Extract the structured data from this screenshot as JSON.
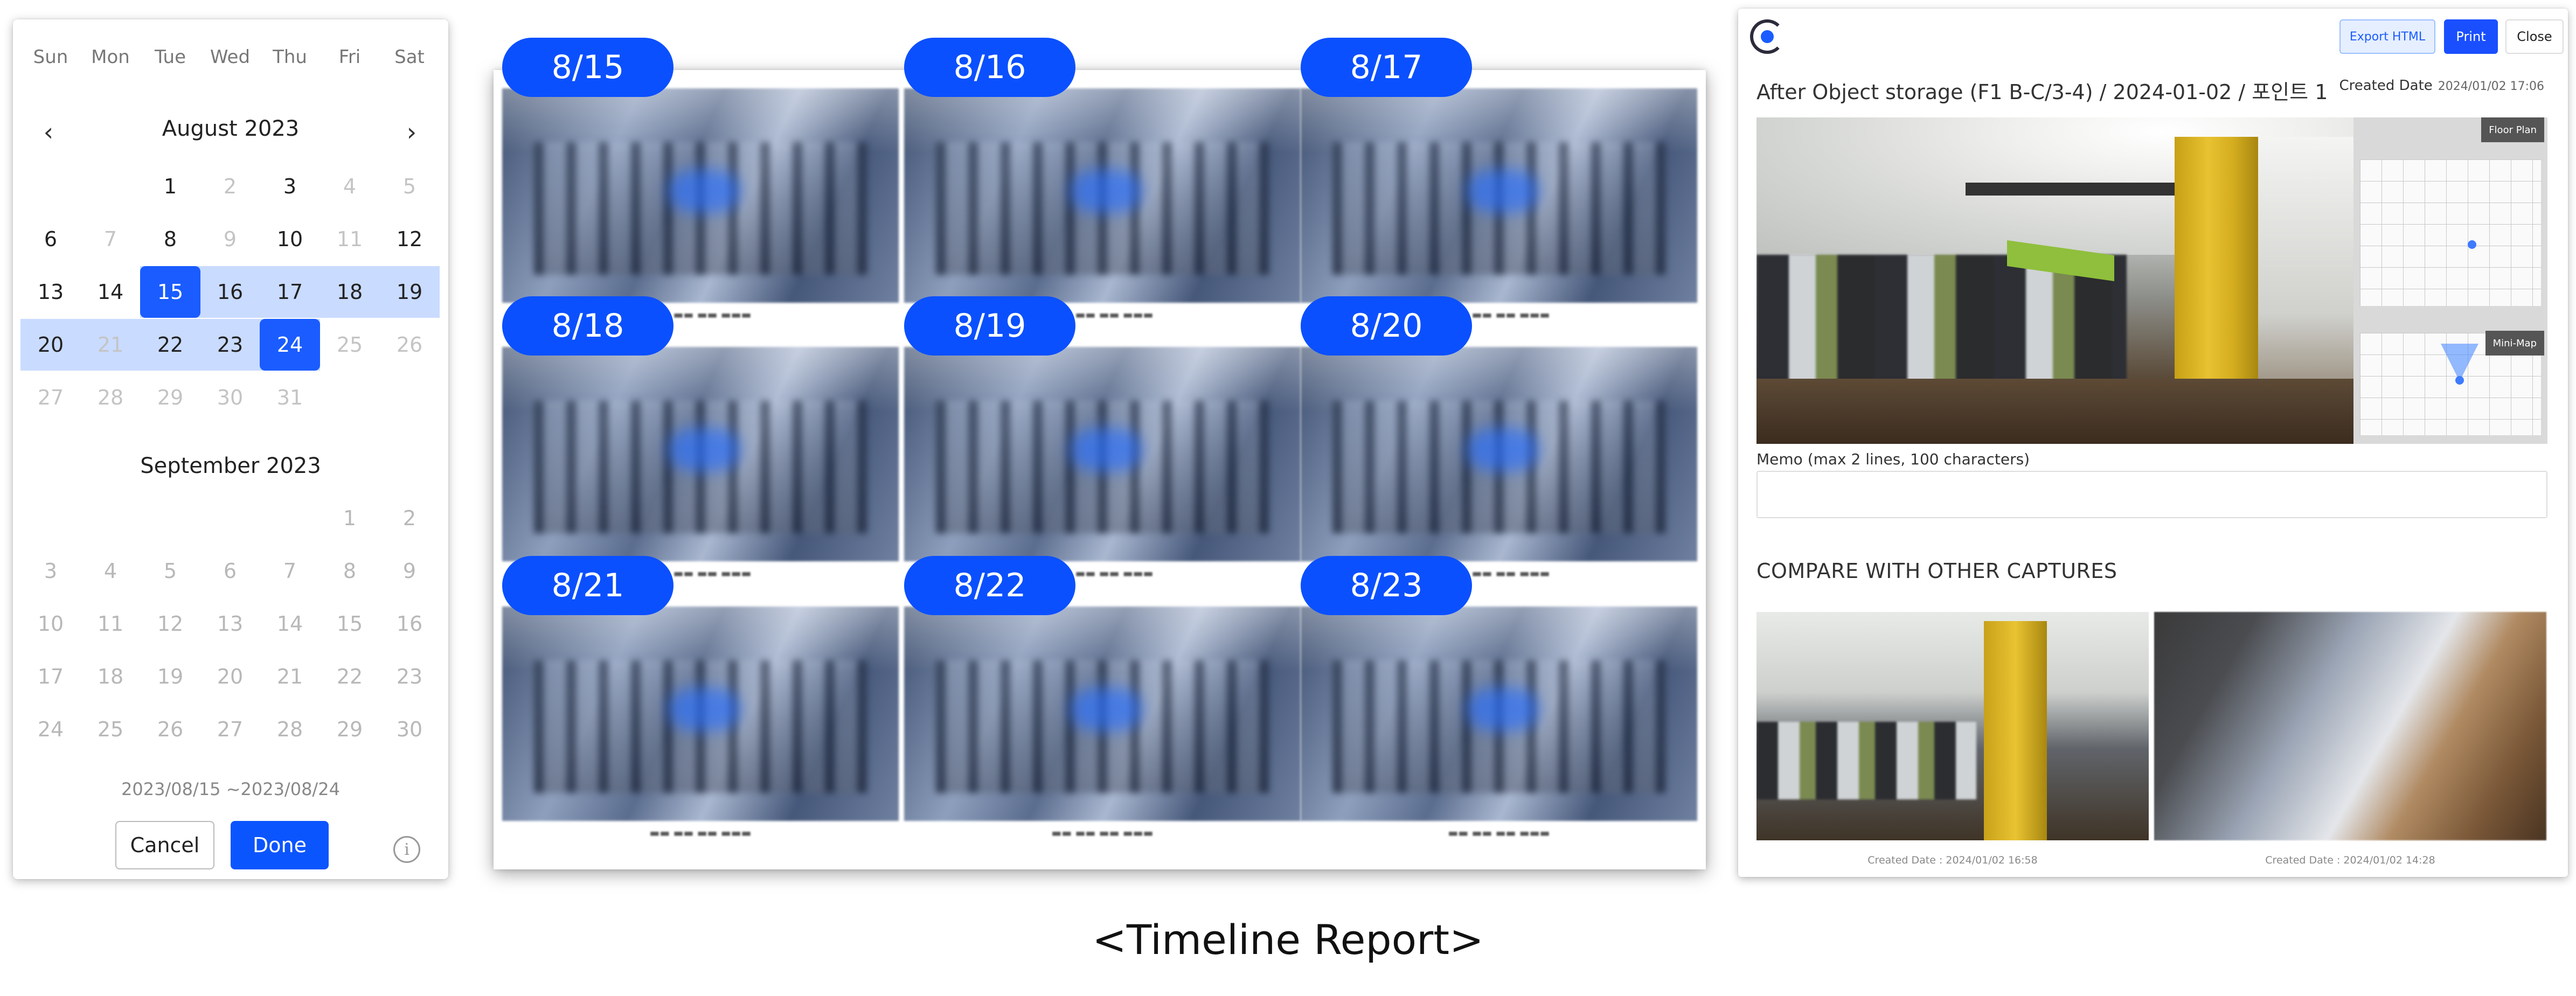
{
  "calendar": {
    "weekdays": [
      "Sun",
      "Mon",
      "Tue",
      "Wed",
      "Thu",
      "Fri",
      "Sat"
    ],
    "month1": {
      "title": "August  2023",
      "weeks": [
        [
          "",
          "",
          "1",
          "2",
          "3",
          "4",
          "5"
        ],
        [
          "6",
          "7",
          "8",
          "9",
          "10",
          "11",
          "12"
        ],
        [
          "13",
          "14",
          "15",
          "16",
          "17",
          "18",
          "19"
        ],
        [
          "20",
          "21",
          "22",
          "23",
          "24",
          "25",
          "26"
        ],
        [
          "27",
          "28",
          "29",
          "30",
          "31",
          "",
          ""
        ]
      ],
      "muted": [
        "2",
        "4",
        "5",
        "7",
        "9",
        "11",
        "21",
        "25",
        "26",
        "27",
        "28",
        "29",
        "30",
        "31"
      ],
      "selected_start": "15",
      "selected_end": "24"
    },
    "month2": {
      "title": "September  2023",
      "weeks": [
        [
          "",
          "",
          "",
          "",
          "",
          "1",
          "2"
        ],
        [
          "3",
          "4",
          "5",
          "6",
          "7",
          "8",
          "9"
        ],
        [
          "10",
          "11",
          "12",
          "13",
          "14",
          "15",
          "16"
        ],
        [
          "17",
          "18",
          "19",
          "20",
          "21",
          "22",
          "23"
        ],
        [
          "24",
          "25",
          "26",
          "27",
          "28",
          "29",
          "30"
        ]
      ]
    },
    "prev_icon": "chevron-left",
    "next_icon": "chevron-right",
    "range_text": "2023/08/15 ~2023/08/24",
    "cancel_label": "Cancel",
    "done_label": "Done",
    "info_icon": "info-icon",
    "accent": "#1a5cff",
    "range_color": "#c9dbff"
  },
  "timeline": {
    "dates": [
      "8/15",
      "8/16",
      "8/17",
      "8/18",
      "8/19",
      "8/20",
      "8/21",
      "8/22",
      "8/23"
    ],
    "pill_color": "#0b50ff"
  },
  "report": {
    "export_label": "Export HTML",
    "print_label": "Print",
    "close_label": "Close",
    "title": "After Object storage (F1 B-C/3-4) / 2024-01-02 / 포인트 1",
    "created_label": "Created Date",
    "created_value": "2024/01/02 17:06",
    "floor_plan_label": "Floor Plan",
    "mini_map_label": "Mini-Map",
    "memo_label": "Memo (max 2 lines, 100 characters)",
    "memo_value": "",
    "compare_title": "COMPARE WITH OTHER CAPTURES",
    "compare": [
      {
        "caption": "Created Date : 2024/01/02 16:58"
      },
      {
        "caption": "Created Date : 2024/01/02 14:28"
      }
    ]
  },
  "footer": {
    "caption": "<Timeline Report>"
  }
}
